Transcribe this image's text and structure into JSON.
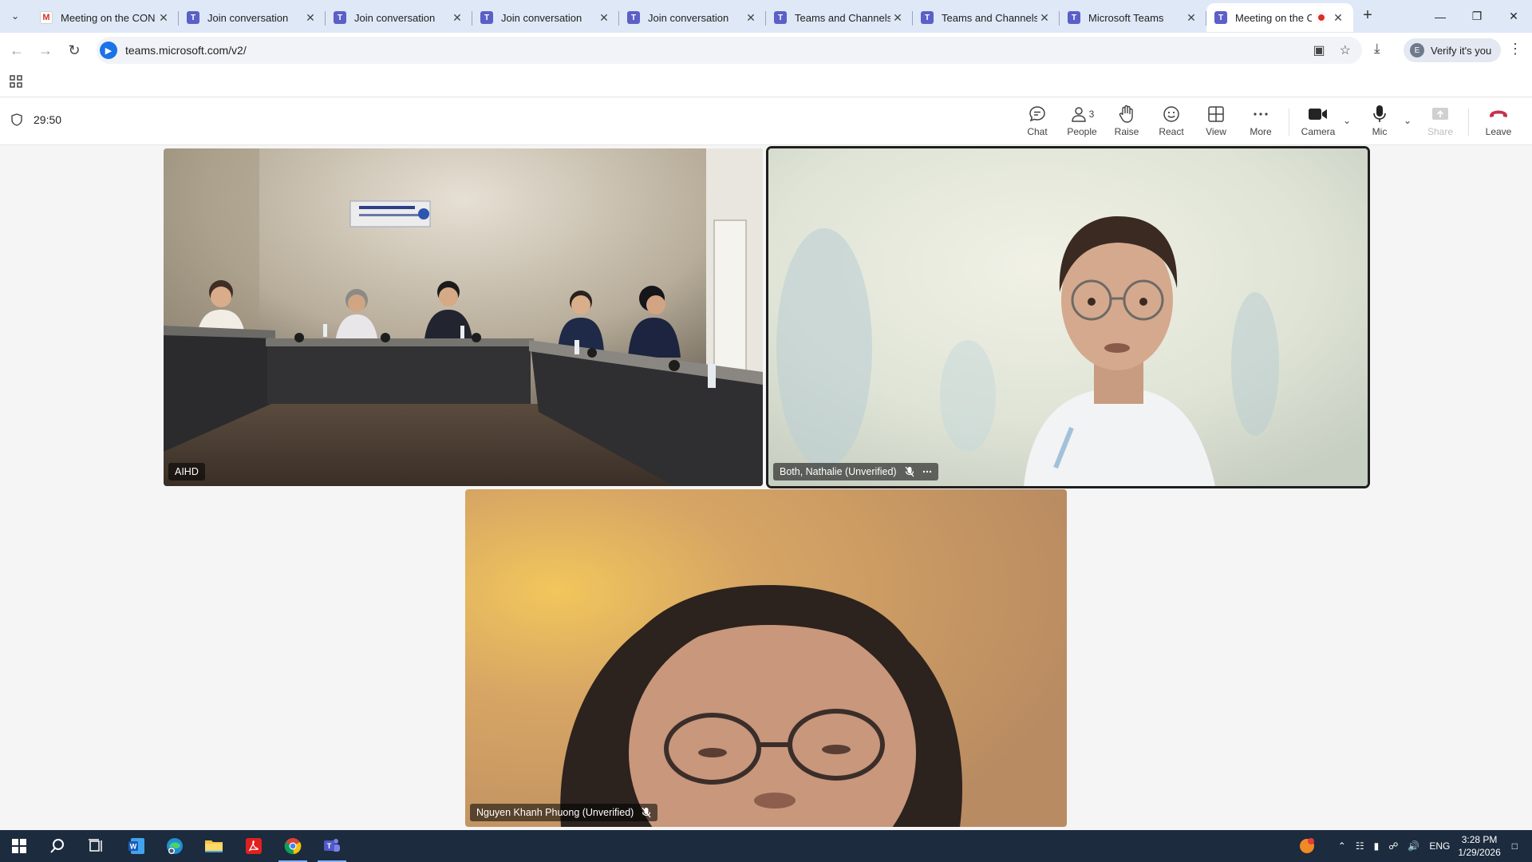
{
  "browser": {
    "tabs": [
      {
        "title": "Meeting on the CON",
        "favicon": "gmail-icon",
        "active": false
      },
      {
        "title": "Join conversation",
        "favicon": "teams-icon",
        "active": false
      },
      {
        "title": "Join conversation",
        "favicon": "teams-icon",
        "active": false
      },
      {
        "title": "Join conversation",
        "favicon": "teams-icon",
        "active": false
      },
      {
        "title": "Join conversation",
        "favicon": "teams-icon",
        "active": false
      },
      {
        "title": "Teams and Channels",
        "favicon": "teams-icon",
        "active": false
      },
      {
        "title": "Teams and Channels",
        "favicon": "teams-icon",
        "active": false
      },
      {
        "title": "Microsoft Teams",
        "favicon": "teams-icon",
        "active": false
      },
      {
        "title": "Meeting on the C",
        "favicon": "teams-icon",
        "active": true,
        "recording": true
      }
    ],
    "url": "teams.microsoft.com/v2/",
    "verify_label": "Verify it's you",
    "profile_initial": "E"
  },
  "meeting": {
    "elapsed": "29:50",
    "controls": [
      {
        "id": "chat",
        "label": "Chat",
        "icon": "chat-icon"
      },
      {
        "id": "people",
        "label": "People",
        "icon": "people-icon",
        "count": "3"
      },
      {
        "id": "raise",
        "label": "Raise",
        "icon": "hand-icon"
      },
      {
        "id": "react",
        "label": "React",
        "icon": "smile-icon"
      },
      {
        "id": "view",
        "label": "View",
        "icon": "grid-icon"
      },
      {
        "id": "more",
        "label": "More",
        "icon": "ellipsis-icon"
      },
      {
        "id": "camera",
        "label": "Camera",
        "icon": "camera-icon"
      },
      {
        "id": "mic",
        "label": "Mic",
        "icon": "mic-icon"
      },
      {
        "id": "share",
        "label": "Share",
        "icon": "share-icon",
        "disabled": true
      },
      {
        "id": "leave",
        "label": "Leave",
        "icon": "hangup-icon"
      }
    ]
  },
  "participants": [
    {
      "name": "AIHD",
      "muted": false,
      "scene": "conference-room"
    },
    {
      "name": "Both, Nathalie (Unverified)",
      "muted": true,
      "speaking": true,
      "scene": "webcam-bright"
    },
    {
      "name": "Nguyen Khanh Phuong (Unverified)",
      "muted": true,
      "scene": "webcam-warm"
    }
  ],
  "taskbar": {
    "apps": [
      "start-icon",
      "search-icon",
      "task-view-icon",
      "word-icon",
      "edge-icon",
      "file-explorer-icon",
      "acrobat-icon",
      "chrome-icon",
      "teams-icon"
    ],
    "language": "ENG",
    "time": "3:28 PM",
    "date": "1/29/2026",
    "colors": {
      "background": "#1c2b3e",
      "accent": "#7fb3ff"
    }
  },
  "colors": {
    "teams_purple": "#5b5fc7",
    "leave_red": "#c4314b",
    "tab_strip": "#dfe8f7"
  }
}
